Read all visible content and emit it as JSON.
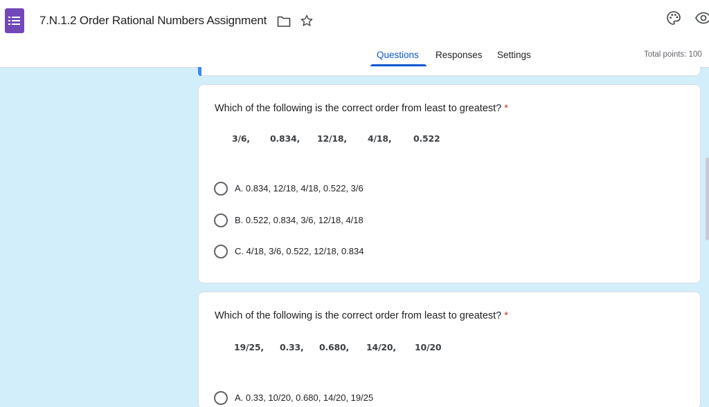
{
  "header": {
    "title": "7.N.1.2 Order Rational Numbers Assignment",
    "icons": [
      "forms-app-icon",
      "folder-icon",
      "star-icon",
      "palette-icon",
      "preview-eye-icon"
    ],
    "accent_color": "#0b57d0",
    "app_color": "#7248b9"
  },
  "tabs": [
    {
      "label": "Questions",
      "active": true
    },
    {
      "label": "Responses",
      "active": false
    },
    {
      "label": "Settings",
      "active": false
    }
  ],
  "total_points": "Total points: 100",
  "questions": [
    {
      "text": "Which of the following is the correct order from least to greatest?",
      "required_mark": "*",
      "numbers": [
        "3/6,",
        "0.834,",
        "12/18,",
        "4/18,",
        "0.522"
      ],
      "options": [
        "A. 0.834, 12/18, 4/18, 0.522, 3/6",
        "B. 0.522, 0.834, 3/6, 12/18, 4/18",
        "C. 4/18, 3/6, 0.522, 12/18, 0.834"
      ]
    },
    {
      "text": "Which of the following is the correct order from least to greatest?",
      "required_mark": "*",
      "numbers": [
        "19/25,",
        "0.33,",
        "0.680,",
        "14/20,",
        "10/20"
      ],
      "options": [
        "A. 0.33, 10/20, 0.680, 14/20, 19/25"
      ]
    }
  ]
}
